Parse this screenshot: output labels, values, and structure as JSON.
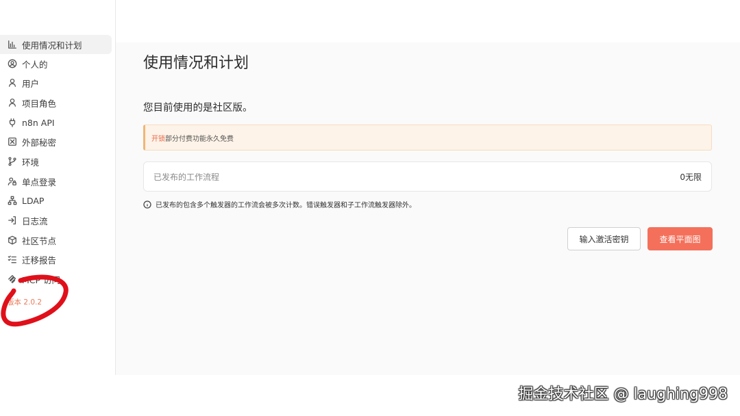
{
  "sidebar": {
    "items": [
      {
        "label": "使用情况和计划",
        "icon": "bar-chart-icon"
      },
      {
        "label": "个人的",
        "icon": "user-circle-icon"
      },
      {
        "label": "用户",
        "icon": "user-icon"
      },
      {
        "label": "项目角色",
        "icon": "user-icon"
      },
      {
        "label": "n8n API",
        "icon": "plug-icon"
      },
      {
        "label": "外部秘密",
        "icon": "vault-icon"
      },
      {
        "label": "环境",
        "icon": "git-branch-icon"
      },
      {
        "label": "单点登录",
        "icon": "user-lock-icon"
      },
      {
        "label": "LDAP",
        "icon": "sitemap-icon"
      },
      {
        "label": "日志流",
        "icon": "sign-in-icon"
      },
      {
        "label": "社区节点",
        "icon": "cube-icon"
      },
      {
        "label": "迁移报告",
        "icon": "checklist-icon"
      },
      {
        "label": "MCP 访问",
        "icon": "mcp-icon"
      }
    ],
    "version": "版本 2.0.2"
  },
  "main": {
    "title": "使用情况和计划",
    "subtitle": "您目前使用的是社区版。",
    "notice": {
      "link": "开锁",
      "text": "部分付费功能永久免费"
    },
    "metric": {
      "label": "已发布的工作流程",
      "value": "0无限"
    },
    "info": "已发布的包含多个触发器的工作流会被多次计数。错误触发器和子工作流触发器除外。",
    "buttons": {
      "activate": "输入激活密钥",
      "plans": "查看平面图"
    }
  },
  "watermark": "掘金技术社区 @ laughing998",
  "colors": {
    "accent": "#f4705b",
    "version": "#ea7a58",
    "annotation": "#e0101a"
  }
}
